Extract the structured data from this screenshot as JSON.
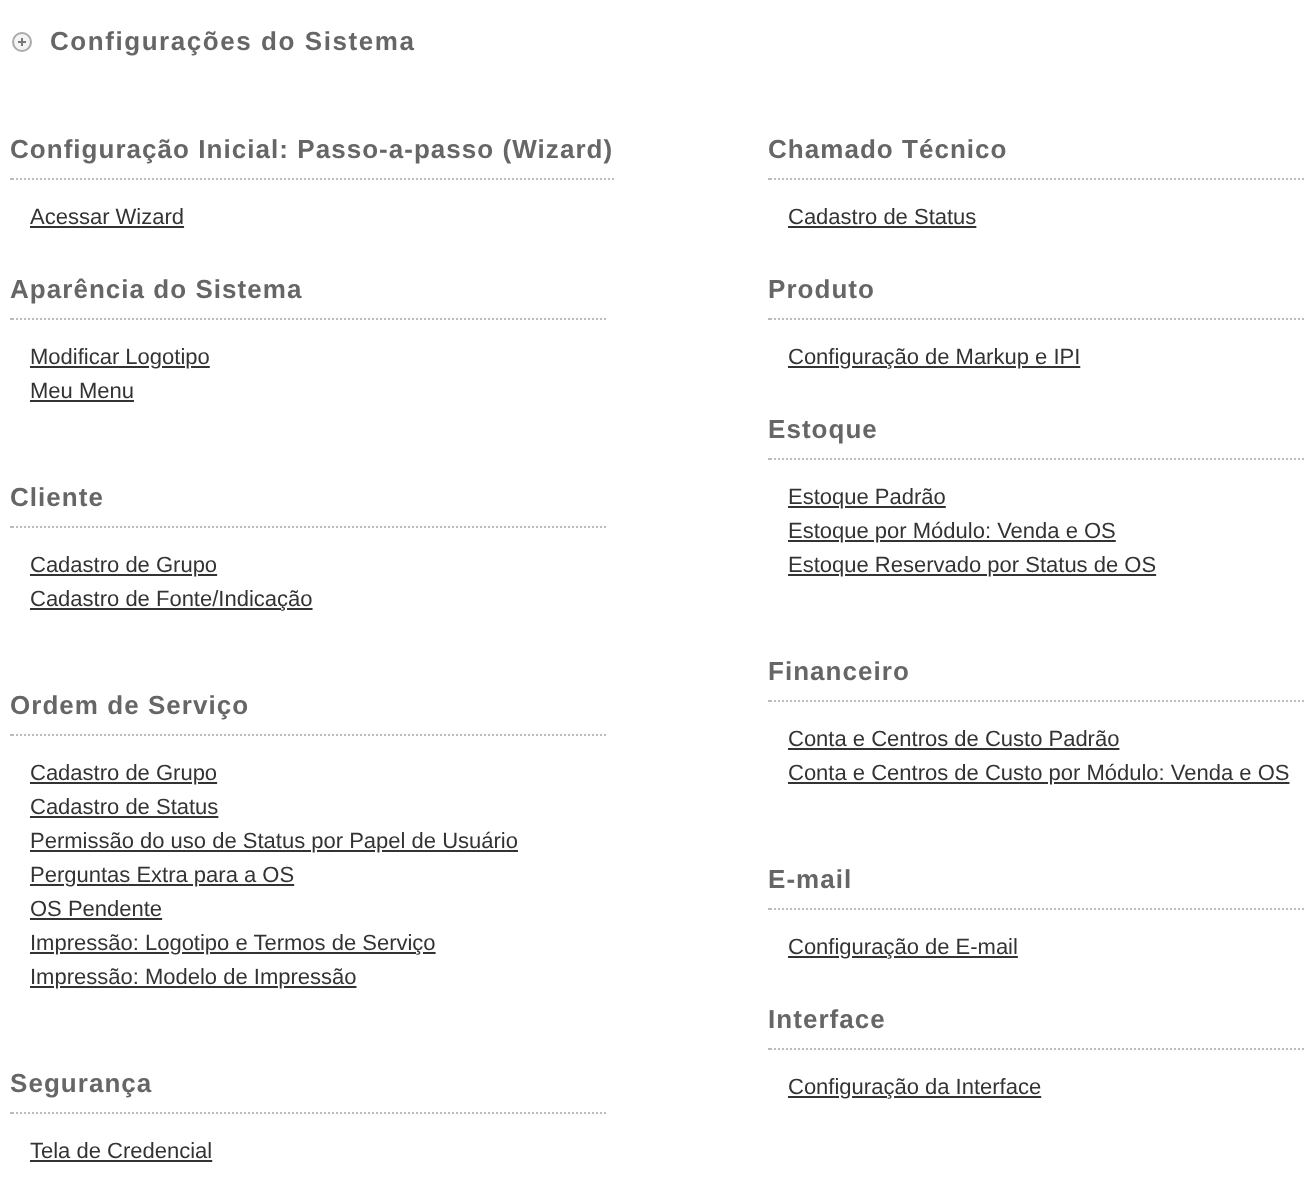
{
  "title": "Configurações do Sistema",
  "columns": [
    [
      {
        "heading": "Configuração Inicial: Passo-a-passo (Wizard)",
        "links": [
          "Acessar Wizard"
        ]
      },
      {
        "heading": "Aparência do Sistema",
        "links": [
          "Modificar Logotipo",
          "Meu Menu"
        ]
      },
      {
        "heading": "Cliente",
        "links": [
          "Cadastro de Grupo",
          "Cadastro de Fonte/Indicação"
        ]
      },
      {
        "heading": "Ordem de Serviço",
        "links": [
          "Cadastro de Grupo",
          "Cadastro de Status",
          "Permissão do uso de Status por Papel de Usuário",
          "Perguntas Extra para a OS",
          "OS Pendente",
          "Impressão: Logotipo e Termos de Serviço",
          "Impressão: Modelo de Impressão"
        ]
      },
      {
        "heading": "Segurança",
        "links": [
          "Tela de Credencial"
        ]
      }
    ],
    [
      {
        "heading": "Chamado Técnico",
        "links": [
          "Cadastro de Status"
        ]
      },
      {
        "heading": "Produto",
        "links": [
          "Configuração de Markup e IPI"
        ]
      },
      {
        "heading": "Estoque",
        "links": [
          "Estoque Padrão",
          "Estoque por Módulo: Venda e OS",
          "Estoque Reservado por Status de OS"
        ]
      },
      {
        "heading": "Financeiro",
        "links": [
          "Conta e Centros de Custo Padrão",
          "Conta e Centros de Custo por Módulo: Venda e OS"
        ]
      },
      {
        "heading": "E-mail",
        "links": [
          "Configuração de E-mail"
        ]
      },
      {
        "heading": "Interface",
        "links": [
          "Configuração da Interface"
        ]
      }
    ]
  ]
}
